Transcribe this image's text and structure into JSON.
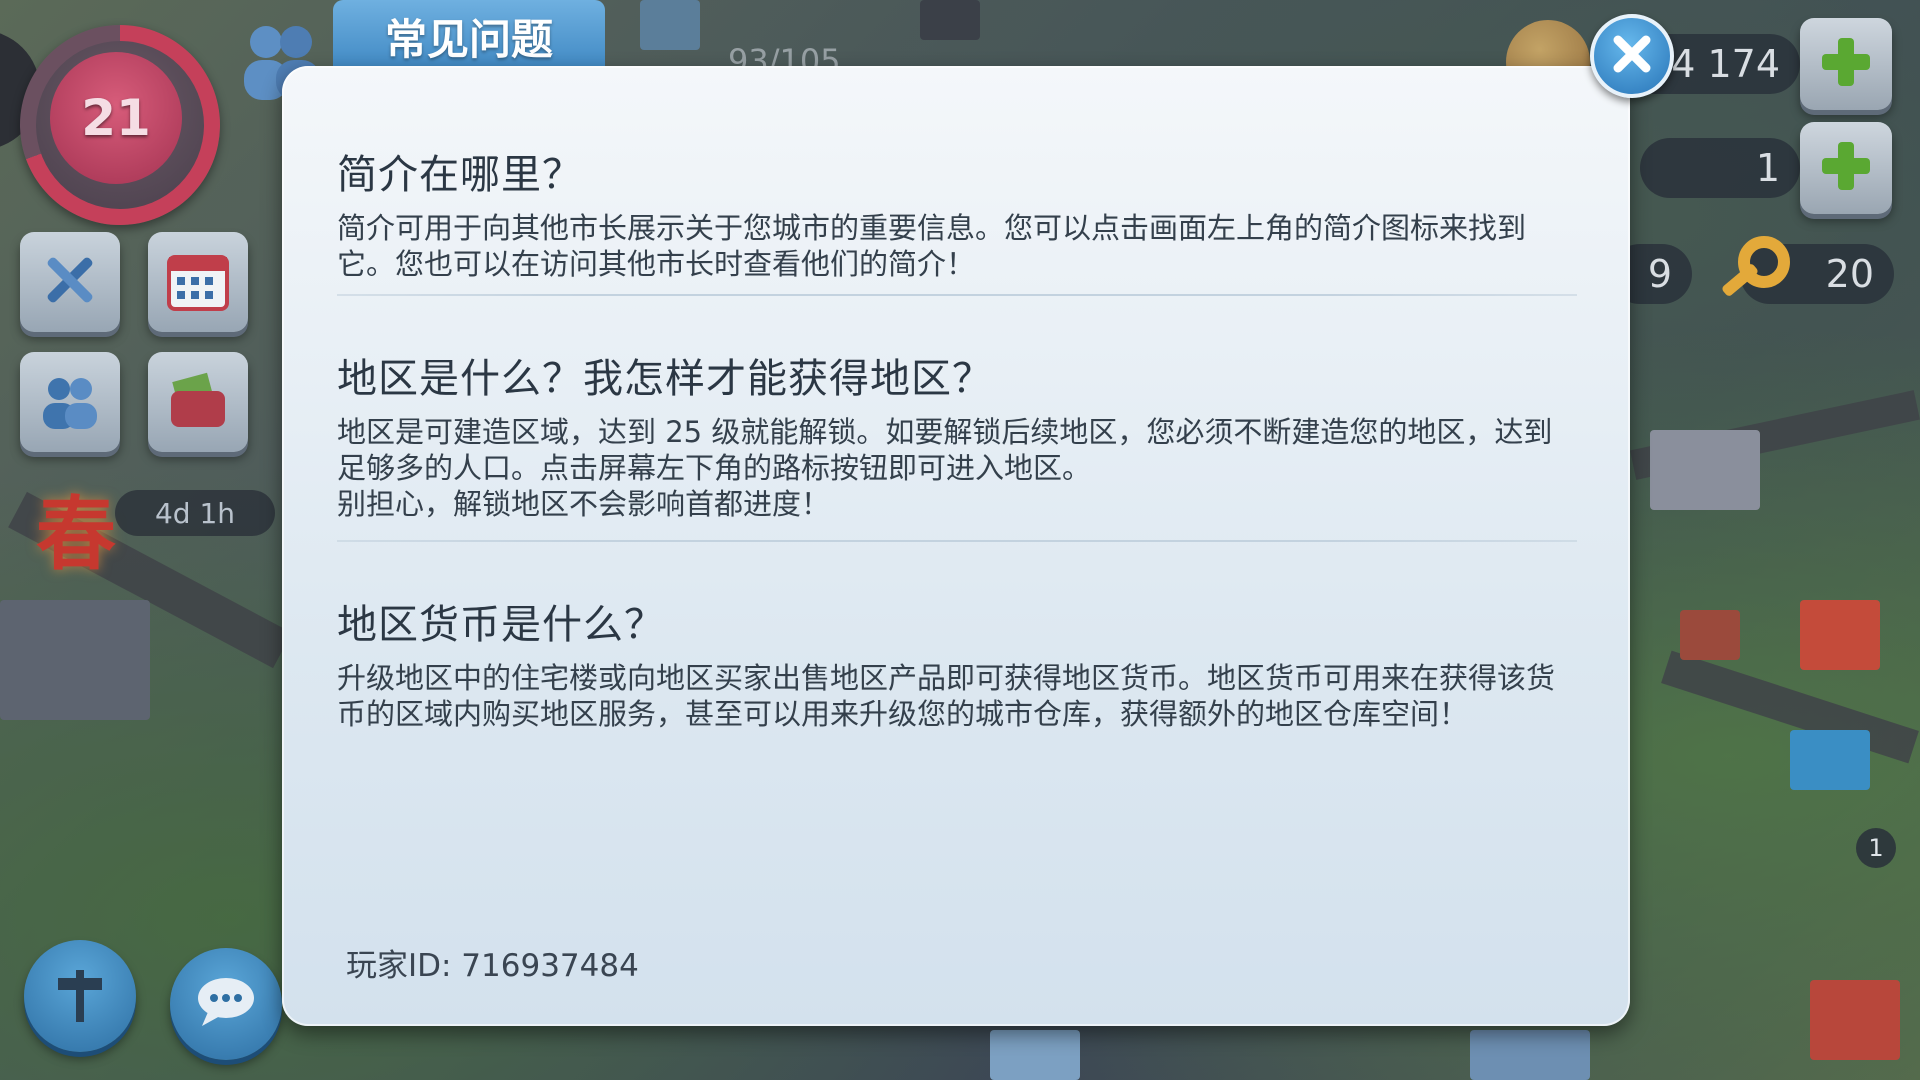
{
  "hud": {
    "level": "21",
    "event_timer": "4d 1h",
    "event_icon_glyph": "春",
    "population": "93/105",
    "simoleons": "14 174",
    "simcash": "1",
    "badge_count": "9",
    "keys": "20",
    "notification_count": "1"
  },
  "modal": {
    "tab_title": "常见问题",
    "faqs": [
      {
        "question": "简介在哪里？",
        "answer": "简介可用于向其他市长展示关于您城市的重要信息。您可以点击画面左上角的简介图标来找到它。您也可以在访问其他市长时查看他们的简介！"
      },
      {
        "question": "地区是什么？我怎样才能获得地区？",
        "answer": "地区是可建造区域，达到 25 级就能解锁。如要解锁后续地区，您必须不断建造您的地区，达到足够多的人口。点击屏幕左下角的路标按钮即可进入地区。\n别担心，解锁地区不会影响首都进度！"
      },
      {
        "question": "地区货币是什么？",
        "answer": "升级地区中的住宅楼或向地区买家出售地区产品即可获得地区货币。地区货币可用来在获得该货币的区域内购买地区服务，甚至可以用来升级您的城市仓库，获得额外的地区仓库空间！"
      }
    ],
    "player_id": "玩家ID: 716937484"
  },
  "colors": {
    "accent_blue": "#3f88c3",
    "level_pink": "#c5405a",
    "plus_green": "#5aa832",
    "panel_bg": "#e6eef5"
  },
  "icons": [
    "tools-icon",
    "calendar-icon",
    "friends-icon",
    "wallet-icon",
    "signpost-icon",
    "chat-icon",
    "close-icon",
    "plus-icon",
    "key-icon",
    "coin-icon"
  ]
}
